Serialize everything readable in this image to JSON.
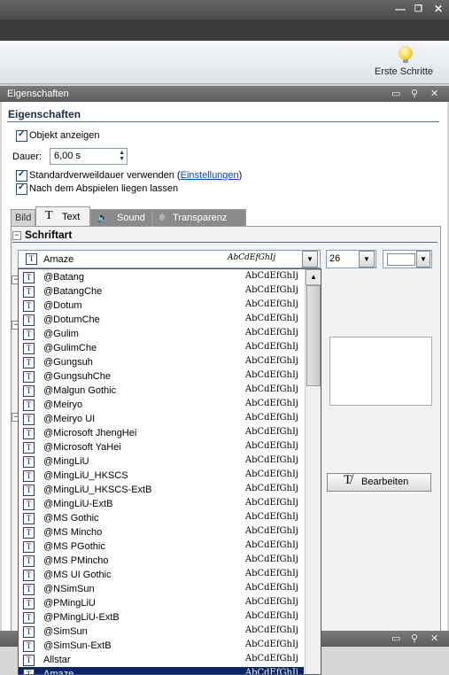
{
  "ribbon": {
    "erste_schritte": "Erste Schritte"
  },
  "panel": {
    "title": "Eigenschaften",
    "section": "Eigenschaften",
    "objekt_anzeigen": "Objekt anzeigen",
    "dauer_label": "Dauer:",
    "dauer_value": "6,00 s",
    "standard_text": "Standardverweildauer verwenden (",
    "einstellungen": "Einstellungen",
    "close_paren": ")",
    "nach_abspielen": "Nach dem Abspielen liegen lassen"
  },
  "tabs": [
    {
      "label": "Bild"
    },
    {
      "label": "Text"
    },
    {
      "label": "Sound"
    },
    {
      "label": "Transparenz"
    }
  ],
  "schriftart": {
    "heading": "Schriftart",
    "selected_font": "Amaze",
    "selected_preview": "AbCdEfGhIj",
    "size": "26"
  },
  "bearbeiten": "Bearbeiten",
  "font_list": [
    {
      "name": "@Batang",
      "preview": "AbCdEfGhIj"
    },
    {
      "name": "@BatangChe",
      "preview": "AbCdEfGhIj"
    },
    {
      "name": "@Dotum",
      "preview": "AbCdEfGhIj"
    },
    {
      "name": "@DotumChe",
      "preview": "AbCdEfGhIj"
    },
    {
      "name": "@Gulim",
      "preview": "AbCdEfGhIj"
    },
    {
      "name": "@GulimChe",
      "preview": "AbCdEfGhIj"
    },
    {
      "name": "@Gungsuh",
      "preview": "AbCdEfGhIj"
    },
    {
      "name": "@GungsuhChe",
      "preview": "AbCdEfGhIj"
    },
    {
      "name": "@Malgun Gothic",
      "preview": "AbCdEfGhIj"
    },
    {
      "name": "@Meiryo",
      "preview": "AbCdEfGhIj"
    },
    {
      "name": "@Meiryo UI",
      "preview": "AbCdEfGhIj"
    },
    {
      "name": "@Microsoft JhengHei",
      "preview": "AbCdEfGhIj"
    },
    {
      "name": "@Microsoft YaHei",
      "preview": "AbCdEfGhIj"
    },
    {
      "name": "@MingLiU",
      "preview": "AbCdEfGhIj"
    },
    {
      "name": "@MingLiU_HKSCS",
      "preview": "AbCdEfGhIj"
    },
    {
      "name": "@MingLiU_HKSCS-ExtB",
      "preview": "AbCdEfGhIj"
    },
    {
      "name": "@MingLiU-ExtB",
      "preview": "AbCdEfGhIj"
    },
    {
      "name": "@MS Gothic",
      "preview": "AbCdEfGhIj"
    },
    {
      "name": "@MS Mincho",
      "preview": "AbCdEfGhIj"
    },
    {
      "name": "@MS PGothic",
      "preview": "AbCdEfGhIj"
    },
    {
      "name": "@MS PMincho",
      "preview": "AbCdEfGhIj"
    },
    {
      "name": "@MS UI Gothic",
      "preview": "AbCdEfGhIj"
    },
    {
      "name": "@NSimSun",
      "preview": "AbCdEfGhIj"
    },
    {
      "name": "@PMingLiU",
      "preview": "AbCdEfGhIj"
    },
    {
      "name": "@PMingLiU-ExtB",
      "preview": "AbCdEfGhIj"
    },
    {
      "name": "@SimSun",
      "preview": "AbCdEfGhIj"
    },
    {
      "name": "@SimSun-ExtB",
      "preview": "AbCdEfGhIj"
    },
    {
      "name": "Allstar",
      "preview": "AbCdEfGhIj"
    },
    {
      "name": "Amaze",
      "preview": "AbCdEfGhIj",
      "selected": true
    }
  ]
}
